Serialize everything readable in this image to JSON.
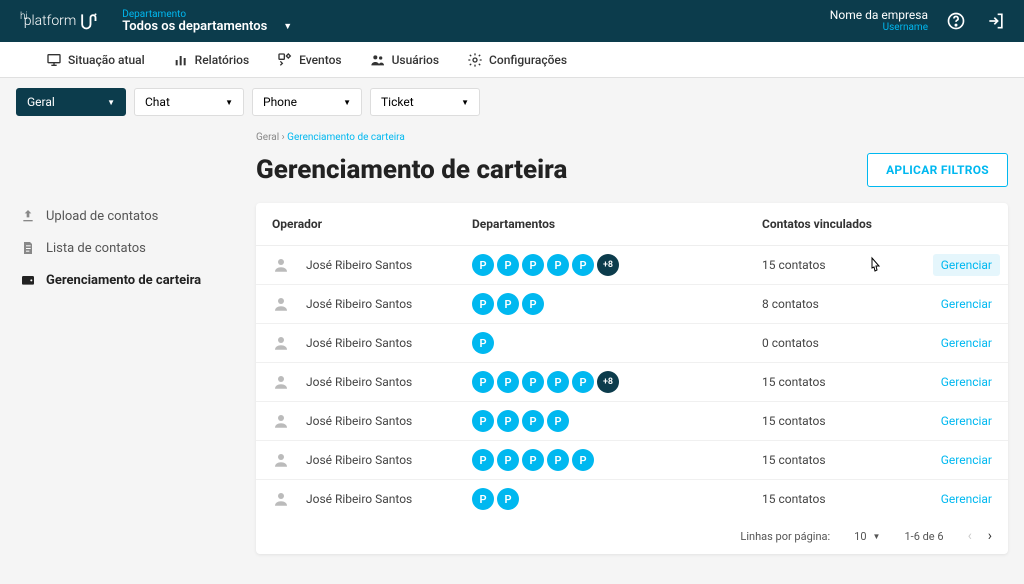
{
  "header": {
    "logo_text": "platform",
    "dept_label": "Departamento",
    "dept_value": "Todos os departamentos",
    "company_name": "Nome da empresa",
    "username": "Username"
  },
  "tabs": [
    {
      "label": "Situação atual"
    },
    {
      "label": "Relatórios"
    },
    {
      "label": "Eventos"
    },
    {
      "label": "Usuários"
    },
    {
      "label": "Configurações"
    }
  ],
  "filters": {
    "geral": "Geral",
    "chat": "Chat",
    "phone": "Phone",
    "ticket": "Ticket"
  },
  "sidebar": [
    {
      "label": "Upload de contatos"
    },
    {
      "label": "Lista de contatos"
    },
    {
      "label": "Gerenciamento de carteira",
      "active": true
    }
  ],
  "breadcrumb": {
    "root": "Geral",
    "current": "Gerenciamento de carteira"
  },
  "page_title": "Gerenciamento de carteira",
  "apply_button": "APLICAR FILTROS",
  "table": {
    "headers": {
      "op": "Operador",
      "dept": "Departamentos",
      "cont": "Contatos vinculados"
    },
    "action_label": "Gerenciar",
    "rows": [
      {
        "name": "José Ribeiro Santos",
        "chips": 5,
        "more": "+8",
        "contacts": "15 contatos",
        "hover": true
      },
      {
        "name": "José Ribeiro Santos",
        "chips": 3,
        "more": null,
        "contacts": "8 contatos"
      },
      {
        "name": "José Ribeiro Santos",
        "chips": 1,
        "more": null,
        "contacts": "0 contatos"
      },
      {
        "name": "José Ribeiro Santos",
        "chips": 5,
        "more": "+8",
        "contacts": "15 contatos"
      },
      {
        "name": "José Ribeiro Santos",
        "chips": 4,
        "more": null,
        "contacts": "15 contatos"
      },
      {
        "name": "José Ribeiro Santos",
        "chips": 5,
        "more": null,
        "contacts": "15 contatos"
      },
      {
        "name": "José Ribeiro Santos",
        "chips": 2,
        "more": null,
        "contacts": "15 contatos"
      }
    ],
    "chip_letter": "P"
  },
  "pagination": {
    "per_page_label": "Linhas por página:",
    "per_page_value": "10",
    "range": "1-6 de 6"
  }
}
